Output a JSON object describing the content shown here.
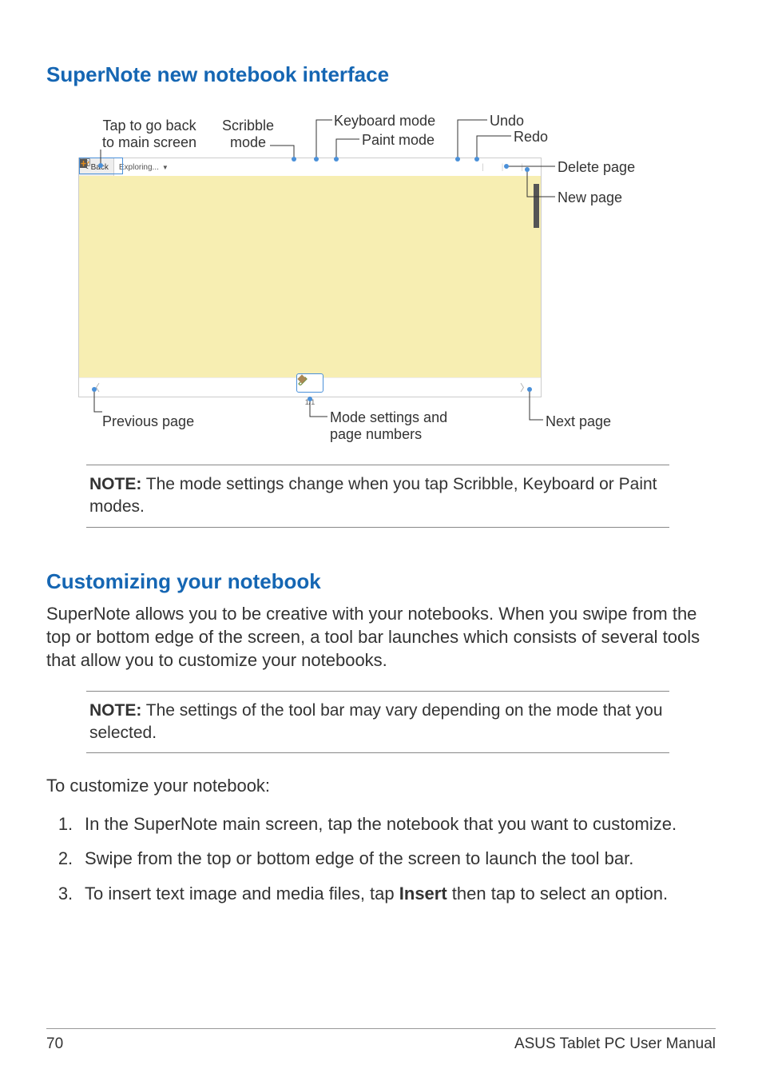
{
  "heading1": "SuperNote new notebook interface",
  "diagram": {
    "labels": {
      "back": "Tap to go back\nto main screen",
      "scribble": "Scribble\nmode",
      "keyboard": "Keyboard mode",
      "paint": "Paint mode",
      "undo": "Undo",
      "redo": "Redo",
      "delete": "Delete page",
      "newpage": "New page",
      "prev": "Previous page",
      "modesettings": "Mode settings and\npage numbers",
      "next": "Next page"
    },
    "toolbar": {
      "back_label": "< Back",
      "doc_title": "Exploring...",
      "page_indicator": "1/1"
    }
  },
  "note1": {
    "prefix": "NOTE:",
    "text": "  The mode settings change when you tap Scribble, Keyboard or Paint modes."
  },
  "heading2": "Customizing your notebook",
  "intro": "SuperNote allows you to be creative with your notebooks. When you swipe from the top or bottom edge of the screen, a tool bar launches which consists of several tools that allow you to customize your notebooks.",
  "note2": {
    "prefix": "NOTE:",
    "text": "  The settings of the tool bar may vary depending on the mode that you selected."
  },
  "steps_intro": "To customize your notebook:",
  "steps": [
    {
      "num": "1.",
      "text": "In the SuperNote main screen, tap the notebook that you want to customize."
    },
    {
      "num": "2.",
      "text": "Swipe from the top or bottom edge of the screen to launch the tool bar."
    },
    {
      "num": "3.",
      "pre": "To insert text image and media files, tap ",
      "bold": "Insert",
      "post": " then tap to select an option."
    }
  ],
  "footer": {
    "page": "70",
    "title": "ASUS Tablet PC User Manual"
  }
}
